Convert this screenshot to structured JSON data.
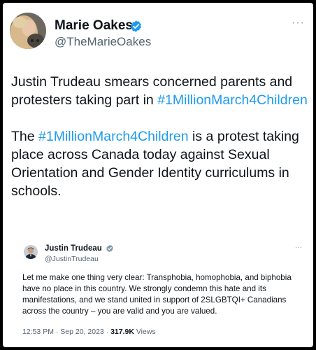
{
  "tweet": {
    "author": {
      "name": "Marie Oakes",
      "handle": "@TheMarieOakes",
      "verified": true
    },
    "paragraph1": {
      "text": "Justin Trudeau smears concerned parents and protesters taking part in ",
      "hashtag": "#1MillionMarch4Children"
    },
    "paragraph2": {
      "before": "The ",
      "hashtag": "#1MillionMarch4Children",
      "after": " is a protest taking place across Canada today against Sexual Orientation and Gender Identity curriculums in schools."
    },
    "more_label": "···",
    "colors": {
      "link": "#1d9bf0",
      "verified": "#1d9bf0",
      "secondary": "#536471"
    }
  },
  "quoted_tweet": {
    "author": {
      "name": "Justin Trudeau",
      "handle": "@JustinTrudeau",
      "verified": true
    },
    "text": "Let me make one thing very clear: Transphobia, homophobia, and biphobia have no place in this country. We strongly condemn this hate and its manifestations, and we stand united in support of 2SLGBTQI+ Canadians across the country – you are valid and you are valued.",
    "timestamp": "12:53 PM · Sep 20, 2023 · ",
    "views_count": "317.9K",
    "views_label": " Views",
    "more_label": "···"
  }
}
